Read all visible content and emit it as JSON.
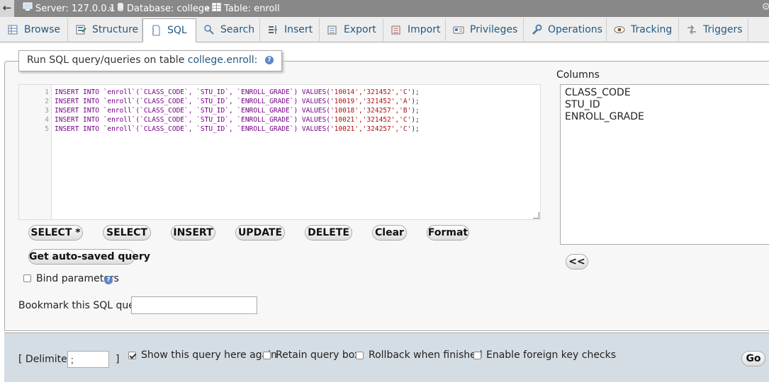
{
  "breadcrumb": {
    "back": "←",
    "server": "Server: 127.0.0.1",
    "database": "Database: college",
    "table": "Table: enroll",
    "sep": "»"
  },
  "tabs": [
    {
      "label": "Browse",
      "icon": "browse-icon"
    },
    {
      "label": "Structure",
      "icon": "structure-icon"
    },
    {
      "label": "SQL",
      "icon": "sql-icon"
    },
    {
      "label": "Search",
      "icon": "search-icon"
    },
    {
      "label": "Insert",
      "icon": "insert-icon"
    },
    {
      "label": "Export",
      "icon": "export-icon"
    },
    {
      "label": "Import",
      "icon": "import-icon"
    },
    {
      "label": "Privileges",
      "icon": "privileges-icon"
    },
    {
      "label": "Operations",
      "icon": "operations-icon"
    },
    {
      "label": "Tracking",
      "icon": "tracking-icon"
    },
    {
      "label": "Triggers",
      "icon": "triggers-icon"
    }
  ],
  "query_panel": {
    "legend_prefix": "Run SQL query/queries on table",
    "legend_table": "college.enroll:",
    "lines": [
      {
        "n": "1",
        "values": "'10014','321452','C'"
      },
      {
        "n": "2",
        "values": "'10019','321452','A'"
      },
      {
        "n": "3",
        "values": "'10018','324257','B'"
      },
      {
        "n": "4",
        "values": "'10021','321452','C'"
      },
      {
        "n": "5",
        "values": "'10021','324257','C'"
      }
    ],
    "code_prefix": "INSERT INTO `enroll`(`CLASS_CODE`, `STU_ID`, `ENROLL_GRADE`) VALUES(",
    "code_suffix": ");"
  },
  "buttons": {
    "select_star": "SELECT *",
    "select": "SELECT",
    "insert": "INSERT",
    "update": "UPDATE",
    "delete": "DELETE",
    "clear": "Clear",
    "format": "Format",
    "autosaved": "Get auto-saved query",
    "insert_col": "<<",
    "go": "Go"
  },
  "bind_parameters": {
    "label": "Bind parameters",
    "checked": false
  },
  "bookmark": {
    "label": "Bookmark this SQL query:",
    "value": ""
  },
  "columns": {
    "title": "Columns",
    "items": [
      "CLASS_CODE",
      "STU_ID",
      "ENROLL_GRADE"
    ]
  },
  "options": {
    "delimiter_label": "[ Delimiter",
    "delimiter_value": ";",
    "delimiter_close": "]",
    "show_query": {
      "label": "Show this query here again",
      "checked": true
    },
    "retain_box": {
      "label": "Retain query box",
      "checked": false
    },
    "rollback": {
      "label": "Rollback when finished",
      "checked": false
    },
    "foreign_keys": {
      "label": "Enable foreign key checks",
      "checked": false
    }
  }
}
